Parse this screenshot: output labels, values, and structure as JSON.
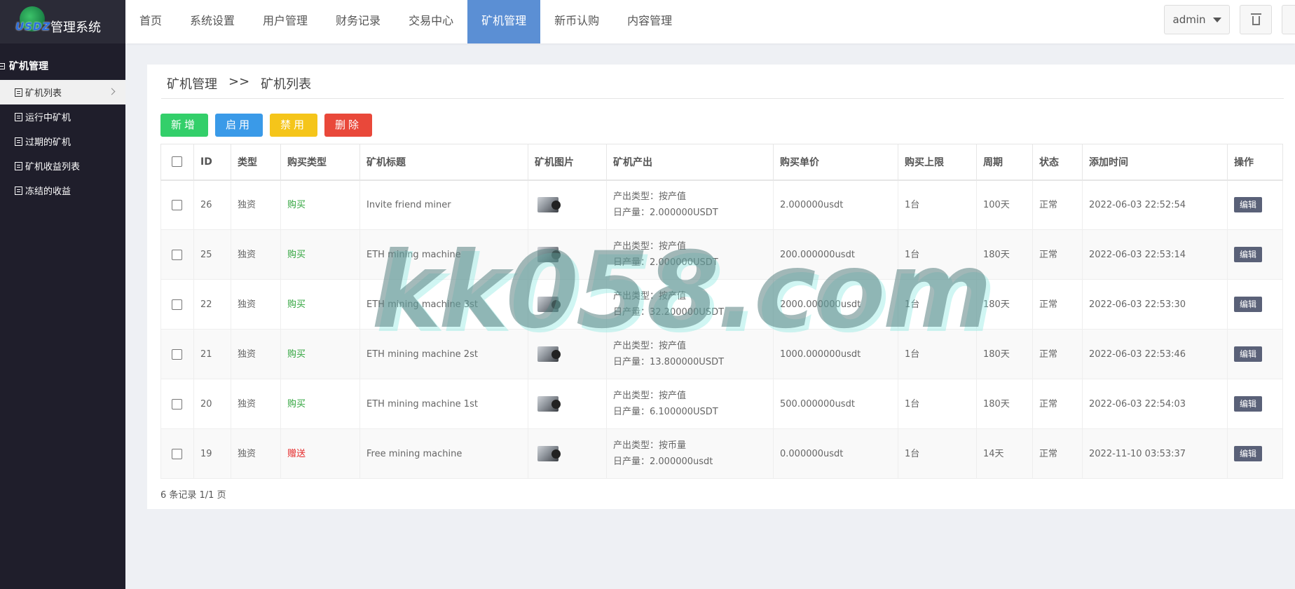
{
  "app": {
    "logo_text": "USDZ",
    "name": "管理系统"
  },
  "sidebar": {
    "group": "矿机管理",
    "items": [
      {
        "label": "矿机列表"
      },
      {
        "label": "运行中矿机"
      },
      {
        "label": "过期的矿机"
      },
      {
        "label": "矿机收益列表"
      },
      {
        "label": "冻结的收益"
      }
    ]
  },
  "nav": {
    "items": [
      {
        "label": "首页"
      },
      {
        "label": "系统设置"
      },
      {
        "label": "用户管理"
      },
      {
        "label": "财务记录"
      },
      {
        "label": "交易中心"
      },
      {
        "label": "矿机管理"
      },
      {
        "label": "新币认购"
      },
      {
        "label": "内容管理"
      }
    ],
    "active": "矿机管理"
  },
  "header": {
    "user": "admin"
  },
  "breadcrumb": {
    "section": "矿机管理",
    "separator": ">>",
    "page": "矿机列表"
  },
  "toolbar": {
    "add": "新增",
    "enable": "启用",
    "disable": "禁用",
    "delete": "删除"
  },
  "table": {
    "headers": [
      "ID",
      "类型",
      "购买类型",
      "矿机标题",
      "矿机图片",
      "矿机产出",
      "购买单价",
      "购买上限",
      "周期",
      "状态",
      "添加时间",
      "操作"
    ],
    "rows": [
      {
        "id": "26",
        "type": "独资",
        "buy_type": "购买",
        "title": "Invite friend miner",
        "output_type": "产出类型：按产值",
        "daily": "日产量：2.000000USDT",
        "price": "2.000000usdt",
        "limit": "1台",
        "period": "100天",
        "status": "正常",
        "time": "2022-06-03 22:52:54",
        "action": "编辑"
      },
      {
        "id": "25",
        "type": "独资",
        "buy_type": "购买",
        "title": "ETH mining machine",
        "output_type": "产出类型：按产值",
        "daily": "日产量：2.000000USDT",
        "price": "200.000000usdt",
        "limit": "1台",
        "period": "180天",
        "status": "正常",
        "time": "2022-06-03 22:53:14",
        "action": "编辑"
      },
      {
        "id": "22",
        "type": "独资",
        "buy_type": "购买",
        "title": "ETH mining machine 3st",
        "output_type": "产出类型：按产值",
        "daily": "日产量：32.200000USDT",
        "price": "2000.000000usdt",
        "limit": "1台",
        "period": "180天",
        "status": "正常",
        "time": "2022-06-03 22:53:30",
        "action": "编辑"
      },
      {
        "id": "21",
        "type": "独资",
        "buy_type": "购买",
        "title": "ETH mining machine 2st",
        "output_type": "产出类型：按产值",
        "daily": "日产量：13.800000USDT",
        "price": "1000.000000usdt",
        "limit": "1台",
        "period": "180天",
        "status": "正常",
        "time": "2022-06-03 22:53:46",
        "action": "编辑"
      },
      {
        "id": "20",
        "type": "独资",
        "buy_type": "购买",
        "title": "ETH mining machine 1st",
        "output_type": "产出类型：按产值",
        "daily": "日产量：6.100000USDT",
        "price": "500.000000usdt",
        "limit": "1台",
        "period": "180天",
        "status": "正常",
        "time": "2022-06-03 22:54:03",
        "action": "编辑"
      },
      {
        "id": "19",
        "type": "独资",
        "buy_type": "赠送",
        "title": "Free mining machine",
        "output_type": "产出类型：按币量",
        "daily": "日产量：2.000000usdt",
        "price": "0.000000usdt",
        "limit": "1台",
        "period": "14天",
        "status": "正常",
        "time": "2022-11-10 03:53:37",
        "action": "编辑"
      }
    ]
  },
  "pagination": {
    "summary": "6 条记录 1/1 页"
  },
  "watermark": "kk058.com"
}
